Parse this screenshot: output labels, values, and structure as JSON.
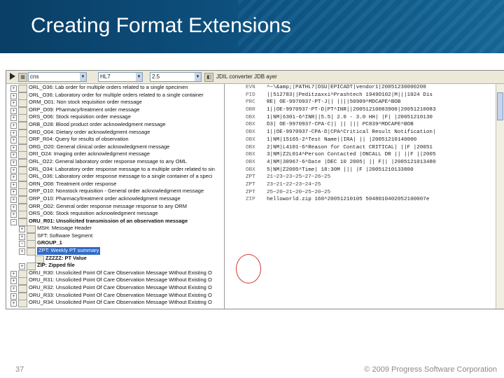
{
  "slide": {
    "title": "Creating Format Extensions",
    "page_number": "37",
    "copyright": "© 2009 Progress Software Corporation"
  },
  "toolbar": {
    "field1": "cns",
    "field2": "HL7",
    "field3": "2.5",
    "converter_label": "JDIL converter JDB ayer"
  },
  "tree": [
    {
      "text": "ORL_O36: Lab order for multiple orders related to a single specimen",
      "indent": 0,
      "exp": "+",
      "style": ""
    },
    {
      "text": "ORL_O36: Laboratory order for multiple orders related to a single container",
      "indent": 0,
      "exp": "+",
      "style": ""
    },
    {
      "text": "ORM_O01: Non stock requisition order message",
      "indent": 0,
      "exp": "+",
      "style": ""
    },
    {
      "text": "ORP_O09: Pharmacy/treatment order message",
      "indent": 0,
      "exp": "+",
      "style": ""
    },
    {
      "text": "ORS_O06: Stock requisition order message",
      "indent": 0,
      "exp": "+",
      "style": ""
    },
    {
      "text": "ORB_O28: Blood product order acknowledgment message",
      "indent": 0,
      "exp": "+",
      "style": ""
    },
    {
      "text": "ORD_O04: Dietary order acknowledgment message",
      "indent": 0,
      "exp": "+",
      "style": ""
    },
    {
      "text": "ORF_R04: Query for results of observation",
      "indent": 0,
      "exp": "+",
      "style": ""
    },
    {
      "text": "ORG_O20: General clinical order acknowledgment message",
      "indent": 0,
      "exp": "+",
      "style": ""
    },
    {
      "text": "ORI_O24: Imaging order acknowledgment message",
      "indent": 0,
      "exp": "+",
      "style": ""
    },
    {
      "text": "ORL_O22: General laboratory order response message to any OML",
      "indent": 0,
      "exp": "+",
      "style": ""
    },
    {
      "text": "ORL_O34: Laboratory order response message to a multiple order related to sin",
      "indent": 0,
      "exp": "+",
      "style": ""
    },
    {
      "text": "ORL_O36: Laboratory order response message to a single container of a speci",
      "indent": 0,
      "exp": "+",
      "style": ""
    },
    {
      "text": "ORN_O08: Treatment order response",
      "indent": 0,
      "exp": "+",
      "style": ""
    },
    {
      "text": "ORP_O10: Nonstock requisition - General order acknowledgment message",
      "indent": 0,
      "exp": "+",
      "style": ""
    },
    {
      "text": "ORP_O10: Pharmacy/treatment order acknowledgment message",
      "indent": 0,
      "exp": "+",
      "style": ""
    },
    {
      "text": "ORR_O02: General order response message response to any ORM",
      "indent": 0,
      "exp": "+",
      "style": ""
    },
    {
      "text": "ORS_O06: Stock requisition acknowledgment message",
      "indent": 0,
      "exp": "+",
      "style": ""
    },
    {
      "text": "ORU_R01: Unsolicited transmission of an observation message",
      "indent": 0,
      "exp": "−",
      "style": "bold"
    },
    {
      "text": "MSH: Message Header",
      "indent": 1,
      "exp": "+",
      "style": ""
    },
    {
      "text": "SFT: Software Segment",
      "indent": 1,
      "exp": "+",
      "style": ""
    },
    {
      "text": "GROUP_1",
      "indent": 1,
      "exp": "−",
      "style": "bold"
    },
    {
      "text": "ZPT: Weekly PT summary",
      "indent": 1,
      "exp": "+",
      "style": "sel"
    },
    {
      "text": "ZZZZZ: PT Value",
      "indent": 2,
      "exp": "",
      "style": "bold"
    },
    {
      "text": "ZIP: Zipped file",
      "indent": 1,
      "exp": "+",
      "style": "bold"
    },
    {
      "text": "ORU_R30: Unsolicited Point Of Care Observation Message Without Existing O",
      "indent": 0,
      "exp": "+",
      "style": ""
    },
    {
      "text": "ORU_R31: Unsolicited Point Of Care Observation Message Without Existing O",
      "indent": 0,
      "exp": "+",
      "style": ""
    },
    {
      "text": "ORU_R32: Unsolicited Point Of Care Observation Message Without Existing O",
      "indent": 0,
      "exp": "+",
      "style": ""
    },
    {
      "text": "ORU_R33: Unsolicited Point Of Care Observation Message Without Existing O",
      "indent": 0,
      "exp": "+",
      "style": ""
    },
    {
      "text": "ORU_R34: Unsolicited Point Of Care Observation Message Without Existing O",
      "indent": 0,
      "exp": "+",
      "style": ""
    }
  ],
  "hl7": [
    {
      "seg": "EVN",
      "text": "^~\\&amp;|PATHL7|DSU|EPICADT|vendor1|20051230000200",
      "hl": false
    },
    {
      "seg": "PID",
      "text": "||512783||Peditzaxxi^Prashtech   1949O102|M|||1024 Dis",
      "hl": false
    },
    {
      "seg": "PRC",
      "text": "RE| OE-9970937-PT-J|| ||||50909^MDCAPE^BOB",
      "hl": false
    },
    {
      "seg": "OBR",
      "text": "1||OE-9970937-PT-D|PT^INR||20051210083900|20051210083",
      "hl": false
    },
    {
      "seg": "OBX",
      "text": "1|NM|6301-6^INR||5.5| 2.0 - 3.0 HH| |F| |20051210130",
      "hl": false
    },
    {
      "seg": "OBX",
      "text": "D3| OE-9970937-CPA-C|| || ||| PC839^MDCAPE^BOB",
      "hl": false
    },
    {
      "seg": "OBX",
      "text": "1||OE-9970937-CPA-D|CPA^Critical Result Notification|",
      "hl": false
    },
    {
      "seg": "OBX",
      "text": "1|NM|15165-2^Test Name||IRA| || |20051210140000",
      "hl": false
    },
    {
      "seg": "OBX",
      "text": "2|NM|L4101-6^Reason for Contact  CRITICAL| ||F |20051",
      "hl": false
    },
    {
      "seg": "OBX",
      "text": "3|NM|Z2L014^Person Contacted |ONCALL DR || ||F ||2005",
      "hl": false
    },
    {
      "seg": "OBX",
      "text": "4|NM|30967-6^Date |DEC 10 2005| || F|| |2005121013480",
      "hl": false
    },
    {
      "seg": "OBX",
      "text": "5|NM|Z2005^Time| 18:30M ||| |F  |20051210133800",
      "hl": false
    },
    {
      "seg": "ZPT",
      "text": "21~23~23~25~27~26~25",
      "hl": true
    },
    {
      "seg": "ZPT",
      "text": "23~21~22~23~24~25",
      "hl": true
    },
    {
      "seg": "ZPT",
      "text": "25~20~21~20~25~20~25",
      "hl": true
    },
    {
      "seg": "ZIP",
      "text": "helloworld.zip 160^20051210105 5048010402052100007e",
      "hl": false
    }
  ]
}
